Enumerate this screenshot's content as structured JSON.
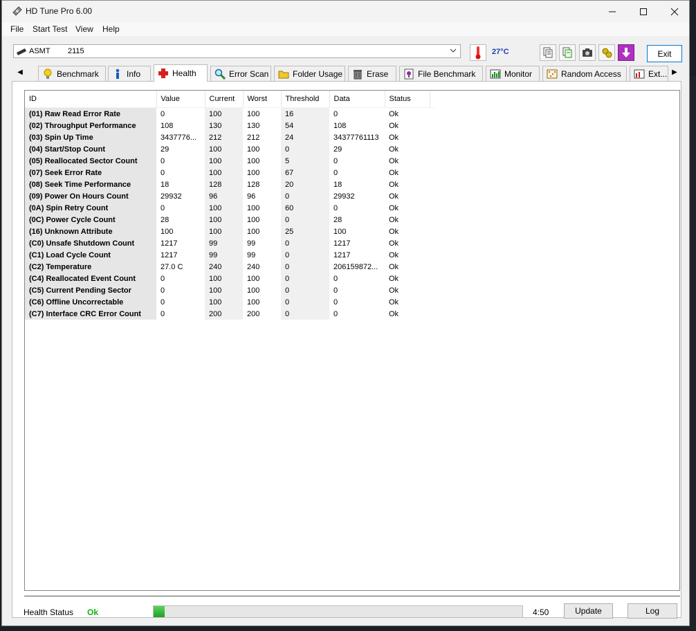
{
  "window": {
    "title": "HD Tune Pro 6.00"
  },
  "menu": [
    "File",
    "Start Test",
    "View",
    "Help"
  ],
  "toolbar": {
    "drive_name": "ASMT",
    "drive_capacity": "2115",
    "temperature": "27°C",
    "exit_label": "Exit"
  },
  "tabs": [
    {
      "label": "Benchmark",
      "icon": "lightbulb-icon"
    },
    {
      "label": "Info",
      "icon": "info-icon"
    },
    {
      "label": "Health",
      "icon": "health-cross-icon",
      "active": true
    },
    {
      "label": "Error Scan",
      "icon": "magnifier-icon"
    },
    {
      "label": "Folder Usage",
      "icon": "folder-icon"
    },
    {
      "label": "Erase",
      "icon": "trash-icon"
    },
    {
      "label": "File Benchmark",
      "icon": "file-benchmark-icon"
    },
    {
      "label": "Monitor",
      "icon": "monitor-chart-icon"
    },
    {
      "label": "Random Access",
      "icon": "random-access-icon"
    },
    {
      "label": "Ext...",
      "icon": "extra-tests-icon"
    }
  ],
  "health_table": {
    "columns": [
      "ID",
      "Value",
      "Current",
      "Worst",
      "Threshold",
      "Data",
      "Status"
    ],
    "rows": [
      [
        "(01) Raw Read Error Rate",
        "0",
        "100",
        "100",
        "16",
        "0",
        "Ok"
      ],
      [
        "(02) Throughput Performance",
        "108",
        "130",
        "130",
        "54",
        "108",
        "Ok"
      ],
      [
        "(03) Spin Up Time",
        "3437776...",
        "212",
        "212",
        "24",
        "34377761113",
        "Ok"
      ],
      [
        "(04) Start/Stop Count",
        "29",
        "100",
        "100",
        "0",
        "29",
        "Ok"
      ],
      [
        "(05) Reallocated Sector Count",
        "0",
        "100",
        "100",
        "5",
        "0",
        "Ok"
      ],
      [
        "(07) Seek Error Rate",
        "0",
        "100",
        "100",
        "67",
        "0",
        "Ok"
      ],
      [
        "(08) Seek Time Performance",
        "18",
        "128",
        "128",
        "20",
        "18",
        "Ok"
      ],
      [
        "(09) Power On Hours Count",
        "29932",
        "96",
        "96",
        "0",
        "29932",
        "Ok"
      ],
      [
        "(0A) Spin Retry Count",
        "0",
        "100",
        "100",
        "60",
        "0",
        "Ok"
      ],
      [
        "(0C) Power Cycle Count",
        "28",
        "100",
        "100",
        "0",
        "28",
        "Ok"
      ],
      [
        "(16) Unknown Attribute",
        "100",
        "100",
        "100",
        "25",
        "100",
        "Ok"
      ],
      [
        "(C0) Unsafe Shutdown Count",
        "1217",
        "99",
        "99",
        "0",
        "1217",
        "Ok"
      ],
      [
        "(C1) Load Cycle Count",
        "1217",
        "99",
        "99",
        "0",
        "1217",
        "Ok"
      ],
      [
        "(C2) Temperature",
        "27.0 C",
        "240",
        "240",
        "0",
        "206159872...",
        "Ok"
      ],
      [
        "(C4) Reallocated Event Count",
        "0",
        "100",
        "100",
        "0",
        "0",
        "Ok"
      ],
      [
        "(C5) Current Pending Sector",
        "0",
        "100",
        "100",
        "0",
        "0",
        "Ok"
      ],
      [
        "(C6) Offline Uncorrectable",
        "0",
        "100",
        "100",
        "0",
        "0",
        "Ok"
      ],
      [
        "(C7) Interface CRC Error Count",
        "0",
        "200",
        "200",
        "0",
        "0",
        "Ok"
      ]
    ]
  },
  "footer": {
    "health_status_label": "Health Status",
    "health_status_value": "Ok",
    "progress_percent": 3,
    "time": "4:50",
    "update_label": "Update",
    "log_label": "Log"
  },
  "colors": {
    "status_ok": "#15b015",
    "temperature": "#1a3fb0",
    "health_cross": "#d62020"
  }
}
